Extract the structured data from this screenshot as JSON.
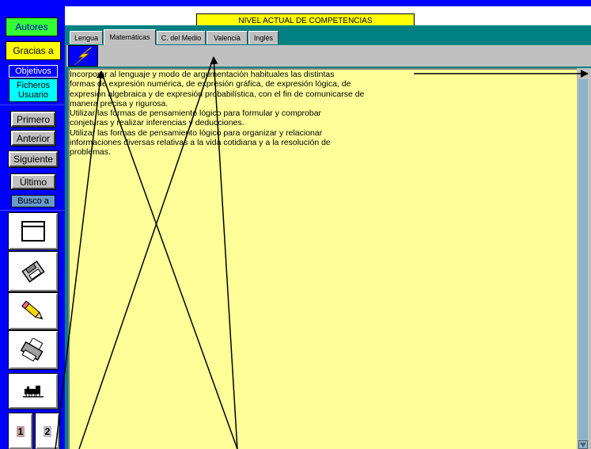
{
  "sidebar": {
    "autores_label": "Autores",
    "gracias_label": "Gracias a",
    "objetivos_label": "Objetivos",
    "ficheros_label": "Ficheros Usuario",
    "primero_label": "Primero",
    "anterior_label": "Anterior",
    "siguiente_label": "Siguiente",
    "ultimo_label": "Último",
    "busco_label": "Busco a",
    "page1_label": "1",
    "page2_label": "2",
    "icons": [
      "window-icon",
      "floppy-disk-icon",
      "pencil-icon",
      "printer-icon",
      "train-icon"
    ]
  },
  "header": {
    "title": "NIVEL ACTUAL DE COMPETENCIAS"
  },
  "tabs": [
    {
      "label": "Lengua",
      "active": false
    },
    {
      "label": "Matemáticas",
      "active": true
    },
    {
      "label": "C. del Medio",
      "active": false
    },
    {
      "label": "Valencià",
      "active": false
    },
    {
      "label": "Inglés",
      "active": false
    }
  ],
  "toolbar": {
    "bolt_icon": "lightning-bolt-icon"
  },
  "content": {
    "lines": [
      "Incorporar al lenguaje y modo de argumentación habituales las distintas",
      "formas de expresión numérica, de expresión gráfica, de expresión lógica, de",
      "expresión algebraica y de expresión probabilística, con el fin de comunicarse de",
      "manera precisa y rigurosa.",
      "Utilizar las formas de pensamiento lógico para formular y comprobar",
      "conjeturas y realizar inferencias y deducciones.",
      "Utilizar las formas de pensamiento lógico para organizar y relacionar",
      "informaciones diversas relativas a la vida cotidiana y a la resolución de",
      "problemas."
    ]
  },
  "colors": {
    "frame": "#0000ff",
    "autores_bg": "#33ff33",
    "gracias_bg": "#ffff00",
    "objetivos_bg": "#0000ff",
    "ficheros_bg": "#00ffff",
    "busco_bg": "#6699cc",
    "text_panel": "#ffff99",
    "tab_area": "#008080"
  }
}
